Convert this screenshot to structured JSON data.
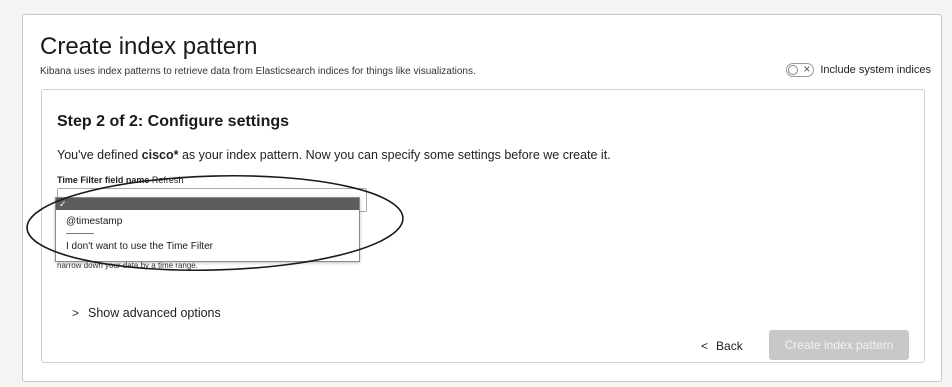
{
  "header": {
    "title": "Create index pattern",
    "subtitle": "Kibana uses index patterns to retrieve data from Elasticsearch indices for things like visualizations.",
    "system_toggle": {
      "label": "Include system indices",
      "x_glyph": "×",
      "checked": false
    }
  },
  "step": {
    "title": "Step 2 of 2: Configure settings",
    "description_before": "You've defined ",
    "pattern": "cisco*",
    "description_after": " as your index pattern. Now you can specify some settings before we create it.",
    "field_label": "Time Filter field name",
    "refresh_label": "Refresh",
    "dropdown": {
      "selected_check": "✓",
      "options": [
        "@timestamp",
        "I don't want to use the Time Filter"
      ]
    },
    "help_text": "narrow down your data by a time range."
  },
  "advanced": {
    "chevron": ">",
    "label": "Show advanced options"
  },
  "footer": {
    "back_chevron": "<",
    "back_label": "Back",
    "create_label": "Create index pattern"
  },
  "colors": {
    "selected_option_bg": "#5c5c5c",
    "disabled_button_bg": "#c8c8c8",
    "annotation_stroke": "#1a1a1a"
  }
}
